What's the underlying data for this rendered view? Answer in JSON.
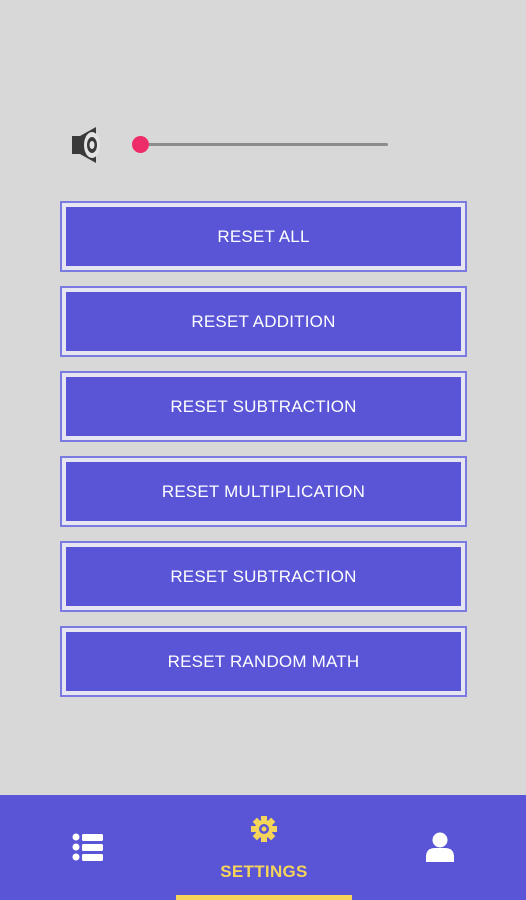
{
  "volume": {
    "level": 0.0,
    "accent_color": "#ee2c6a",
    "icon": "speaker-icon"
  },
  "buttons": [
    {
      "label": "RESET ALL"
    },
    {
      "label": "RESET ADDITION"
    },
    {
      "label": "RESET SUBTRACTION"
    },
    {
      "label": "RESET MULTIPLICATION"
    },
    {
      "label": "RESET SUBTRACTION"
    },
    {
      "label": "RESET RANDOM MATH"
    }
  ],
  "bottom_nav": {
    "items": [
      {
        "icon": "list-icon",
        "label": ""
      },
      {
        "icon": "gear-icon",
        "label": "SETTINGS",
        "active": true
      },
      {
        "icon": "user-icon",
        "label": ""
      }
    ],
    "background": "#5955d6",
    "active_color": "#f5d45a"
  },
  "colors": {
    "button": "#5955d6",
    "background": "#d8d8d8"
  }
}
